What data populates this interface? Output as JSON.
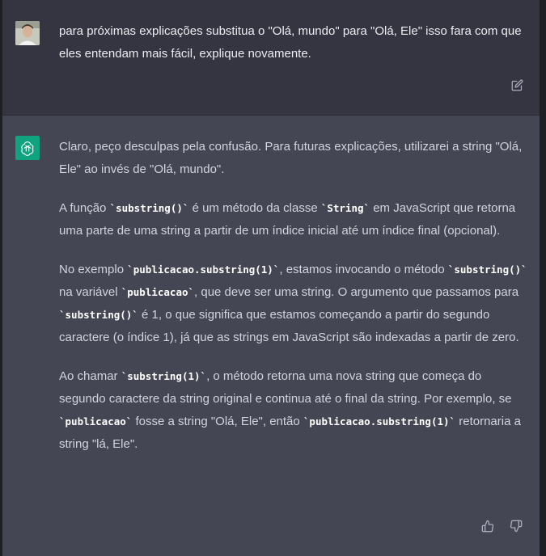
{
  "user_message": {
    "text": "para próximas explicações substitua o \"Olá, mundo\"  para \"Olá, Ele\" isso fara com que eles entendam mais fácil, explique novamente."
  },
  "assistant_message": {
    "p1": "Claro, peço desculpas pela confusão. Para futuras explicações, utilizarei a string \"Olá, Ele\" ao invés de \"Olá, mundo\".",
    "p2": {
      "a": "A função ",
      "code1": "`substring()`",
      "b": " é um método da classe ",
      "code2": "`String`",
      "c": " em JavaScript que retorna uma parte de uma string a partir de um índice inicial até um índice final (opcional)."
    },
    "p3": {
      "a": "No exemplo ",
      "code1": "`publicacao.substring(1)`",
      "b": ", estamos invocando o método ",
      "code2": "`substring()`",
      "c": " na variável ",
      "code3": "`publicacao`",
      "d": ", que deve ser uma string. O argumento que passamos para ",
      "code4": "`substring()`",
      "e": " é 1, o que significa que estamos começando a partir do segundo caractere (o índice 1), já que as strings em JavaScript são indexadas a partir de zero."
    },
    "p4": {
      "a": "Ao chamar ",
      "code1": "`substring(1)`",
      "b": ", o método retorna uma nova string que começa do segundo caractere da string original e continua até o final da string. Por exemplo, se ",
      "code2": "`publicacao`",
      "c": " fosse a string \"Olá, Ele\", então ",
      "code3": "`publicacao.substring(1)`",
      "d": " retornaria a string \"lá, Ele\"."
    }
  },
  "icons": {
    "user_avatar": "user-avatar",
    "assistant_avatar": "openai-logo-icon",
    "edit": "edit-icon",
    "thumbs_up": "thumbs-up-icon",
    "thumbs_down": "thumbs-down-icon"
  },
  "colors": {
    "user_bg": "#343541",
    "assistant_bg": "#444654",
    "accent": "#10a37f"
  }
}
